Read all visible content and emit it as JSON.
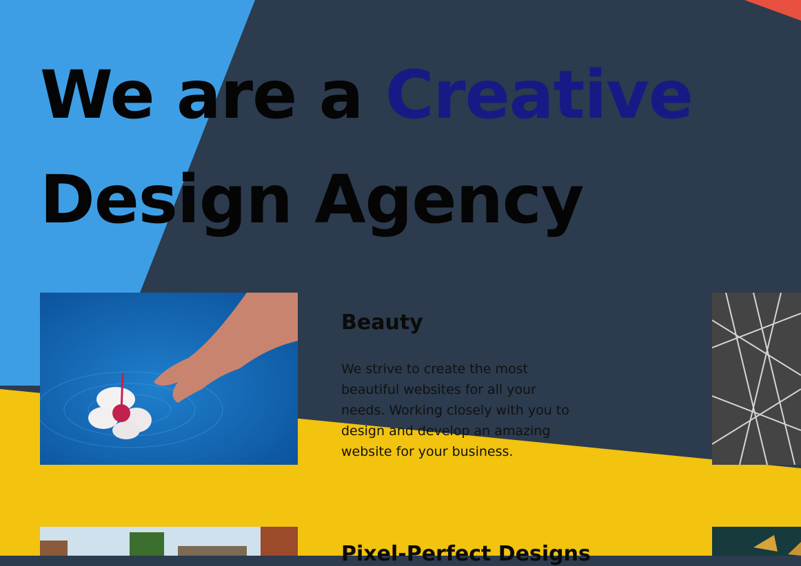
{
  "hero": {
    "line1_prefix": "We are a ",
    "line1_accent": "Creative",
    "line2": "Design Agency"
  },
  "features": [
    {
      "title": "Beauty",
      "description": "We strive to create the most beautiful websites for all your needs. Working closely with you to design and develop an amazing website for your business.",
      "image": "hand-in-water-with-hibiscus-flower"
    },
    {
      "title": "Pixel-Perfect Designs",
      "image": "pixel-brick-landscape"
    }
  ],
  "side_images": [
    "steel-truss-structure-bw",
    "dark-teal-gold-abstract"
  ],
  "colors": {
    "background_dark": "#2c3b4e",
    "accent_blue": "#3d9ee5",
    "accent_yellow": "#f2c30f",
    "accent_red": "#e8513f",
    "headline_accent": "#171a85"
  }
}
